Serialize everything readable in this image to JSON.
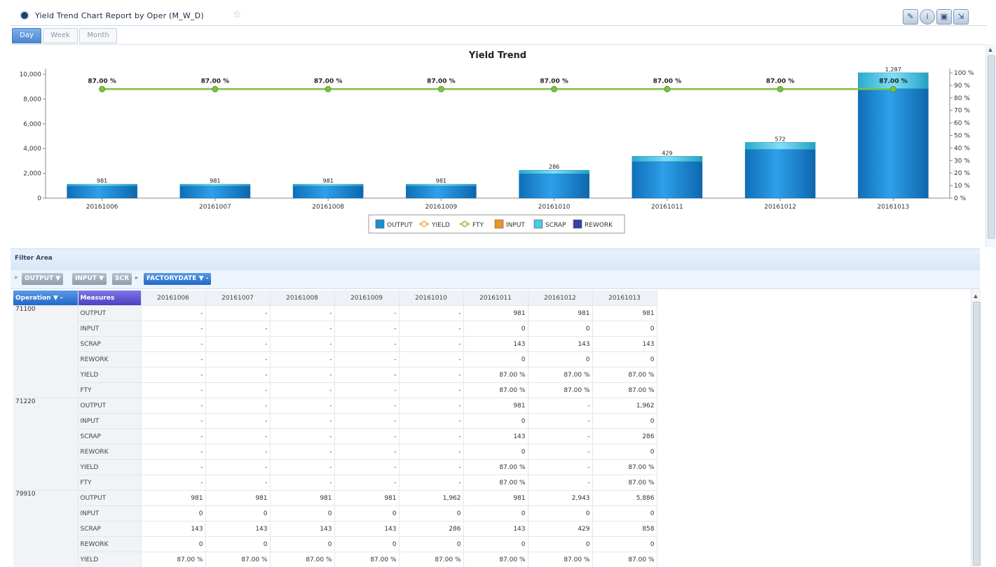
{
  "header": {
    "title": "Yield Trend Chart Report by Oper (M_W_D)",
    "star_icon": "star-icon",
    "tools": [
      "edit-icon",
      "info-icon",
      "save-icon",
      "export-icon"
    ]
  },
  "tabs": [
    {
      "label": "Day",
      "active": true
    },
    {
      "label": "Week",
      "active": false
    },
    {
      "label": "Month",
      "active": false
    }
  ],
  "chart_data": {
    "type": "bar",
    "title": "Yield Trend",
    "categories": [
      "20161006",
      "20161007",
      "20161008",
      "20161009",
      "20161010",
      "20161011",
      "20161012",
      "20161013"
    ],
    "series": [
      {
        "name": "OUTPUT",
        "type": "bar",
        "values": [
          981,
          981,
          981,
          981,
          1962,
          2943,
          3924,
          8829
        ],
        "color": "#1b90d8"
      },
      {
        "name": "YIELD",
        "type": "line",
        "values": [
          87,
          87,
          87,
          87,
          87,
          87,
          87,
          87
        ],
        "color": "#e8a93a"
      },
      {
        "name": "FTY",
        "type": "line",
        "values": [
          87,
          87,
          87,
          87,
          87,
          87,
          87,
          87
        ],
        "color": "#7cc242"
      },
      {
        "name": "INPUT",
        "type": "bar",
        "values": [
          0,
          0,
          0,
          0,
          0,
          0,
          0,
          0
        ],
        "color": "#f0922a"
      },
      {
        "name": "SCRAP",
        "type": "bar",
        "values": [
          143,
          143,
          143,
          143,
          286,
          429,
          572,
          1287
        ],
        "color": "#4cc7e6"
      },
      {
        "name": "REWORK",
        "type": "bar",
        "values": [
          0,
          0,
          0,
          0,
          0,
          0,
          0,
          0
        ],
        "color": "#3b3fa8"
      }
    ],
    "bar_labels": [
      "981",
      "981",
      "981",
      "981",
      "286",
      "429",
      "572",
      "1,287"
    ],
    "line_labels": [
      "87.00 %",
      "87.00 %",
      "87.00 %",
      "87.00 %",
      "87.00 %",
      "87.00 %",
      "87.00 %",
      "87.00 %"
    ],
    "y_left": {
      "min": 0,
      "max": 10000,
      "ticks": [
        "0",
        "2,000",
        "4,000",
        "6,000",
        "8,000",
        "10,000"
      ]
    },
    "y_right": {
      "min": 0,
      "max": 100,
      "ticks": [
        "0 %",
        "10 %",
        "20 %",
        "30 %",
        "40 %",
        "50 %",
        "60 %",
        "70 %",
        "80 %",
        "90 %",
        "100 %"
      ]
    },
    "legend": [
      "OUTPUT",
      "YIELD",
      "FTY",
      "INPUT",
      "SCRAP",
      "REWORK"
    ],
    "legend_position": "bottom-center",
    "grid": false
  },
  "filter": {
    "label": "Filter Area",
    "pills": [
      "OUTPUT",
      "INPUT",
      "SCR"
    ],
    "column_pill": "FACTORYDATE",
    "row_pills": [
      "Operation",
      "Measures"
    ]
  },
  "grid": {
    "columns": [
      "20161006",
      "20161007",
      "20161008",
      "20161009",
      "20161010",
      "20161011",
      "20161012",
      "20161013"
    ],
    "groups": [
      {
        "operation": "71100",
        "rows": [
          {
            "measure": "OUTPUT",
            "values": [
              "-",
              "-",
              "-",
              "-",
              "-",
              "981",
              "981",
              "981"
            ]
          },
          {
            "measure": "INPUT",
            "values": [
              "-",
              "-",
              "-",
              "-",
              "-",
              "0",
              "0",
              "0"
            ]
          },
          {
            "measure": "SCRAP",
            "values": [
              "-",
              "-",
              "-",
              "-",
              "-",
              "143",
              "143",
              "143"
            ]
          },
          {
            "measure": "REWORK",
            "values": [
              "-",
              "-",
              "-",
              "-",
              "-",
              "0",
              "0",
              "0"
            ]
          },
          {
            "measure": "YIELD",
            "values": [
              "-",
              "-",
              "-",
              "-",
              "-",
              "87.00 %",
              "87.00 %",
              "87.00 %"
            ]
          },
          {
            "measure": "FTY",
            "values": [
              "-",
              "-",
              "-",
              "-",
              "-",
              "87.00 %",
              "87.00 %",
              "87.00 %"
            ]
          }
        ]
      },
      {
        "operation": "71220",
        "rows": [
          {
            "measure": "OUTPUT",
            "values": [
              "-",
              "-",
              "-",
              "-",
              "-",
              "981",
              "-",
              "1,962"
            ]
          },
          {
            "measure": "INPUT",
            "values": [
              "-",
              "-",
              "-",
              "-",
              "-",
              "0",
              "-",
              "0"
            ]
          },
          {
            "measure": "SCRAP",
            "values": [
              "-",
              "-",
              "-",
              "-",
              "-",
              "143",
              "-",
              "286"
            ]
          },
          {
            "measure": "REWORK",
            "values": [
              "-",
              "-",
              "-",
              "-",
              "-",
              "0",
              "-",
              "0"
            ]
          },
          {
            "measure": "YIELD",
            "values": [
              "-",
              "-",
              "-",
              "-",
              "-",
              "87.00 %",
              "-",
              "87.00 %"
            ]
          },
          {
            "measure": "FTY",
            "values": [
              "-",
              "-",
              "-",
              "-",
              "-",
              "87.00 %",
              "-",
              "87.00 %"
            ]
          }
        ]
      },
      {
        "operation": "79910",
        "rows": [
          {
            "measure": "OUTPUT",
            "values": [
              "981",
              "981",
              "981",
              "981",
              "1,962",
              "981",
              "2,943",
              "5,886"
            ]
          },
          {
            "measure": "INPUT",
            "values": [
              "0",
              "0",
              "0",
              "0",
              "0",
              "0",
              "0",
              "0"
            ]
          },
          {
            "measure": "SCRAP",
            "values": [
              "143",
              "143",
              "143",
              "143",
              "286",
              "143",
              "429",
              "858"
            ]
          },
          {
            "measure": "REWORK",
            "values": [
              "0",
              "0",
              "0",
              "0",
              "0",
              "0",
              "0",
              "0"
            ]
          },
          {
            "measure": "YIELD",
            "values": [
              "87.00 %",
              "87.00 %",
              "87.00 %",
              "87.00 %",
              "87.00 %",
              "87.00 %",
              "87.00 %",
              "87.00 %"
            ]
          }
        ]
      }
    ]
  }
}
